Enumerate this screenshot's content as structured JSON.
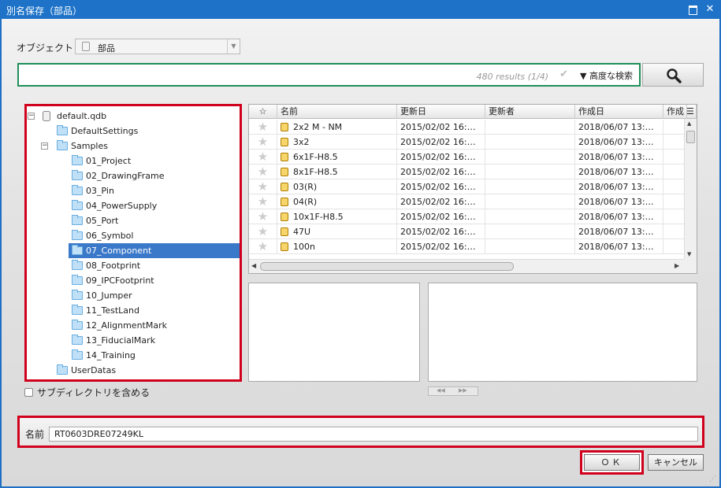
{
  "window": {
    "title": "別名保存（部品）"
  },
  "object": {
    "label": "オブジェクト",
    "value": "部品"
  },
  "search": {
    "results": "480 results (1/4)",
    "advanced_label": "▼ 高度な検索"
  },
  "tree": {
    "items": [
      {
        "label": "default.qdb",
        "icon": "database-icon",
        "expander": "⊟"
      },
      {
        "label": "DefaultSettings",
        "icon": "folder-icon"
      },
      {
        "label": "Samples",
        "icon": "folder-icon",
        "expander": "⊟"
      },
      {
        "label": "01_Project",
        "icon": "folder-icon"
      },
      {
        "label": "02_DrawingFrame",
        "icon": "folder-icon"
      },
      {
        "label": "03_Pin",
        "icon": "folder-icon"
      },
      {
        "label": "04_PowerSupply",
        "icon": "folder-icon"
      },
      {
        "label": "05_Port",
        "icon": "folder-icon"
      },
      {
        "label": "06_Symbol",
        "icon": "folder-icon"
      },
      {
        "label": "07_Component",
        "icon": "folder-icon",
        "selected": true
      },
      {
        "label": "08_Footprint",
        "icon": "folder-icon"
      },
      {
        "label": "09_IPCFootprint",
        "icon": "folder-icon"
      },
      {
        "label": "10_Jumper",
        "icon": "folder-icon"
      },
      {
        "label": "11_TestLand",
        "icon": "folder-icon"
      },
      {
        "label": "12_AlignmentMark",
        "icon": "folder-icon"
      },
      {
        "label": "13_FiducialMark",
        "icon": "folder-icon"
      },
      {
        "label": "14_Training",
        "icon": "folder-icon"
      },
      {
        "label": "UserDatas",
        "icon": "folder-icon"
      }
    ]
  },
  "subdir": {
    "label": "サブディレクトリを含める",
    "checked": false
  },
  "grid": {
    "columns": [
      "☆",
      "名前",
      "更新日",
      "更新者",
      "作成日",
      "作成"
    ],
    "rows": [
      {
        "name": "2x2 M - NM",
        "updated": "2015/02/02 16:…",
        "updater": "",
        "created": "2018/06/07 13:…"
      },
      {
        "name": "3x2",
        "updated": "2015/02/02 16:…",
        "updater": "",
        "created": "2018/06/07 13:…"
      },
      {
        "name": "6x1F-H8.5",
        "updated": "2015/02/02 16:…",
        "updater": "",
        "created": "2018/06/07 13:…"
      },
      {
        "name": "8x1F-H8.5",
        "updated": "2015/02/02 16:…",
        "updater": "",
        "created": "2018/06/07 13:…"
      },
      {
        "name": "03(R)",
        "updated": "2015/02/02 16:…",
        "updater": "",
        "created": "2018/06/07 13:…"
      },
      {
        "name": "04(R)",
        "updated": "2015/02/02 16:…",
        "updater": "",
        "created": "2018/06/07 13:…"
      },
      {
        "name": "10x1F-H8.5",
        "updated": "2015/02/02 16:…",
        "updater": "",
        "created": "2018/06/07 13:…"
      },
      {
        "name": "47U",
        "updated": "2015/02/02 16:…",
        "updater": "",
        "created": "2018/06/07 13:…"
      },
      {
        "name": "100n",
        "updated": "2015/02/02 16:…",
        "updater": "",
        "created": "2018/06/07 13:…"
      }
    ]
  },
  "name_field": {
    "label": "名前",
    "value": "RT0603DRE07249KL"
  },
  "buttons": {
    "ok": "ＯＫ",
    "cancel": "キャンセル"
  },
  "colors": {
    "title_bar": "#1e73c8",
    "highlight": "#d0001c",
    "search_border": "#1f8f5a",
    "selection": "#3a78c9"
  }
}
